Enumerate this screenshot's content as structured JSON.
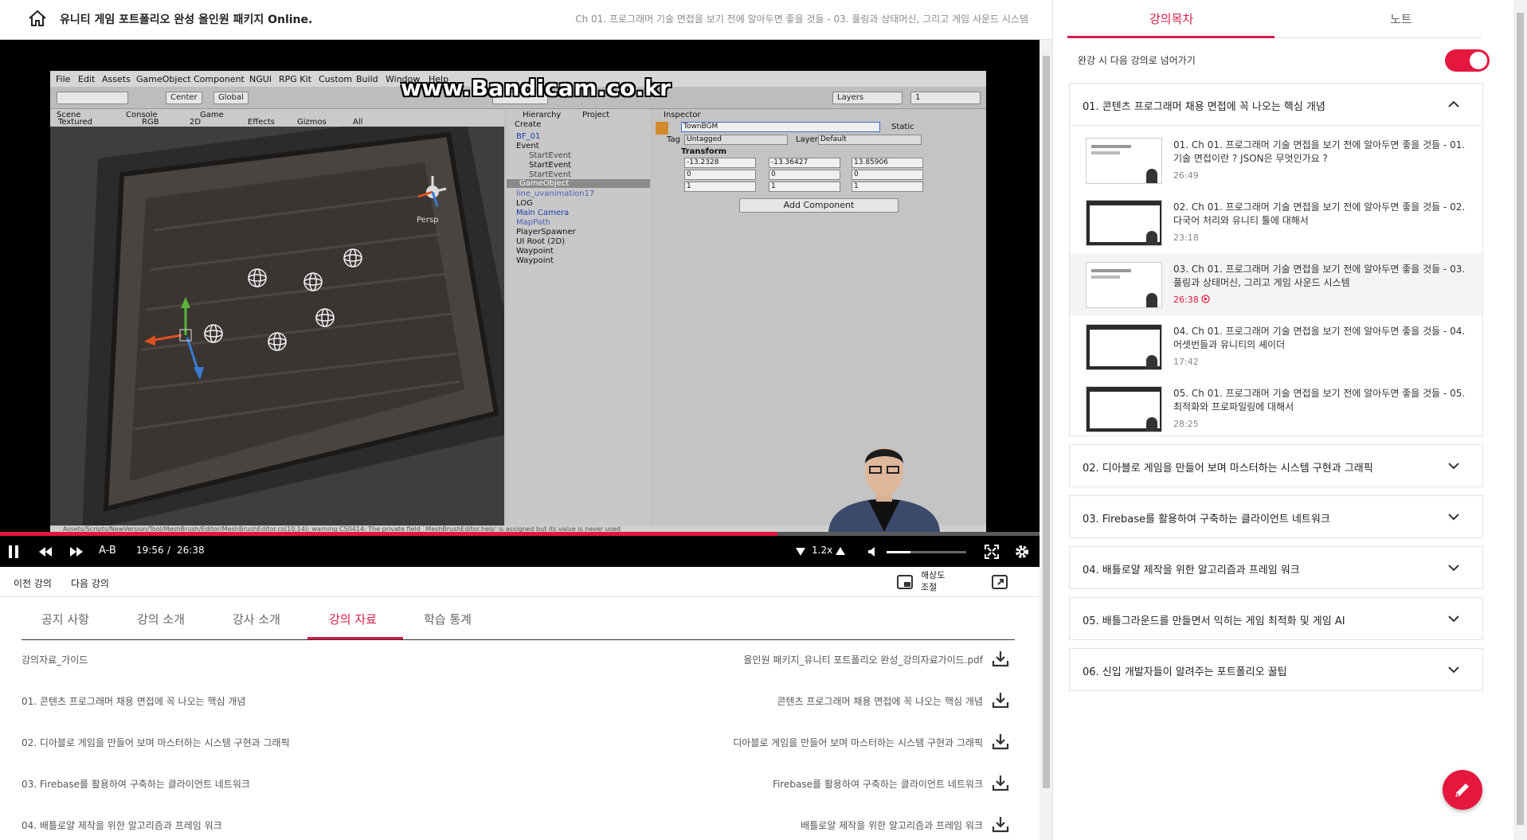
{
  "header": {
    "course_title": "유니티 게임 포트폴리오 완성 올인원 패키지 Online.",
    "chapter_title": "Ch 01. 프로그래머 기술 면접을 보기 전에 알아두면 좋을 것들 - 03. 풀링과 상태머신, 그리고 게임 사운드 시스템"
  },
  "video": {
    "watermark": "www.Bandicam.co.kr",
    "unity_menu": [
      "File",
      "Edit",
      "Assets",
      "GameObject",
      "Component",
      "NGUI",
      "RPG Kit",
      "Custom",
      "Build",
      "Window",
      "Help"
    ],
    "unity_toolbar": {
      "center": "Center",
      "global": "Global",
      "layers": "Layers",
      "layout": "1"
    },
    "scene_tabs": {
      "scene": "Scene",
      "console": "Console",
      "game": "Game",
      "textured": "Textured",
      "rgb": "RGB",
      "twod": "2D",
      "effects": "Effects",
      "gizmos": "Gizmos",
      "all": "All",
      "persp": "Persp"
    },
    "hierarchy": {
      "tab": "Hierarchy",
      "project_tab": "Project",
      "create": "Create",
      "items": [
        "BF_01",
        "Event",
        "StartEvent",
        "StartEvent",
        "StartEvent",
        "GameObject",
        "line_uvanimation17",
        "LOG",
        "Main Camera",
        "MapPath",
        "PlayerSpawner",
        "UI Root (2D)",
        "Waypoint",
        "Waypoint"
      ]
    },
    "inspector": {
      "tab": "Inspector",
      "object_name": "TownBGM",
      "static": "Static",
      "tag_label": "Tag",
      "tag_value": "Untagged",
      "layer_label": "Layer",
      "layer_value": "Default",
      "transform": "Transform",
      "pos": {
        "x": "-13.2328",
        "y": "-13.36427",
        "z": "13.85906"
      },
      "rot": {
        "x": "0",
        "y": "0",
        "z": "0"
      },
      "scale": {
        "x": "1",
        "y": "1",
        "z": "1"
      },
      "add_component": "Add Component"
    },
    "status_line": "Assets/Scripts/NewVersion/Tool/MeshBrush/Editor/MeshBrushEditor.cs(10,14): warning CS0414: The private field `MeshBrushEditor.help' is assigned but its value is never used",
    "progress_fraction": 0.748,
    "volume_fraction": 0.3,
    "controls": {
      "ab": "A-B",
      "current_time": "19:56",
      "separator": "/",
      "duration": "26:38",
      "speed": "1.2x"
    }
  },
  "below_player": {
    "prev": "이전 강의",
    "next": "다음 강의",
    "resolution": "해상도 조절"
  },
  "tabs": [
    {
      "label": "공지 사항"
    },
    {
      "label": "강의 소개"
    },
    {
      "label": "강사 소개"
    },
    {
      "label": "강의 자료"
    },
    {
      "label": "학습 통계"
    }
  ],
  "materials": [
    {
      "left": "강의자료_가이드",
      "right": "올인원 패키지_유니티 포트폴리오 완성_강의자료가이드.pdf"
    },
    {
      "left": "01. 콘텐츠 프로그래머 채용 면접에 꼭 나오는 핵심 개념",
      "right": "콘텐츠 프로그래머 채용 면접에 꼭 나오는 핵심 개념"
    },
    {
      "left": "02. 디아블로 게임을 만들어 보며 마스터하는 시스템 구현과 그래픽",
      "right": "디아블로 게임을 만들어 보며 마스터하는 시스템 구현과 그래픽"
    },
    {
      "left": "03. Firebase를 활용하여 구축하는 클라이언트 네트워크",
      "right": "Firebase를 활용하여 구축하는 클라이언트 네트워크"
    },
    {
      "left": "04. 배틀로얄 제작을 위한 알고리즘과 프레임 워크",
      "right": "배틀로얄 제작을 위한 알고리즘과 프레임 워크"
    }
  ],
  "sidebar": {
    "tab_curriculum": "강의목차",
    "tab_notes": "노트",
    "autoplay_label": "완강 시 다음 강의로 넘어가기",
    "autoplay_on": true,
    "sections": [
      {
        "title": "01. 콘텐츠 프로그래머 채용 면접에 꼭 나오는 핵심 개념",
        "expanded": true
      },
      {
        "title": "02. 디아블로 게임을 만들어 보며 마스터하는 시스템 구현과 그래픽",
        "expanded": false
      },
      {
        "title": "03. Firebase를 활용하여 구축하는 클라이언트 네트워크",
        "expanded": false
      },
      {
        "title": "04. 배틀로얄 제작을 위한 알고리즘과 프레임 워크",
        "expanded": false
      },
      {
        "title": "05. 배틀그라운드를 만들면서 익히는 게임 최적화 및 게임 AI",
        "expanded": false
      },
      {
        "title": "06. 신입 개발자들이 알려주는 포트폴리오 꿀팁",
        "expanded": false
      }
    ],
    "lessons": [
      {
        "title": "01. Ch 01. 프로그래머 기술 면접을 보기 전에 알아두면 좋을 것들 - 01. 기술 면접이란 ? JSON은 무엇인가요 ?",
        "time": "26:49",
        "completed": true,
        "thumb_text": "게임 사전 지식 - 01"
      },
      {
        "title": "02. Ch 01. 프로그래머 기술 면접을 보기 전에 알아두면 좋을 것들 - 02. 다국어 처리와 유니티 툴에 대해서",
        "time": "23:18",
        "completed": true,
        "thumb_text": ""
      },
      {
        "title": "03. Ch 01. 프로그래머 기술 면접을 보기 전에 알아두면 좋을 것들 - 03. 풀링과 상태머신, 그리고 게임 사운드 시스템",
        "time": "26:38",
        "completed": false,
        "current": true,
        "thumb_text": "게임 사전 지식 - 03"
      },
      {
        "title": "04. Ch 01. 프로그래머 기술 면접을 보기 전에 알아두면 좋을 것들 - 04. 어셋번들과 유니티의 셰이더",
        "time": "17:42",
        "completed": false,
        "thumb_text": ""
      },
      {
        "title": "05. Ch 01. 프로그래머 기술 면접을 보기 전에 알아두면 좋을 것들 - 05. 최적화와 프로파일링에 대해서",
        "time": "28:25",
        "completed": false,
        "thumb_text": ""
      }
    ]
  },
  "colors": {
    "accent": "#e5173f",
    "tab_active": "#d71d4a"
  }
}
